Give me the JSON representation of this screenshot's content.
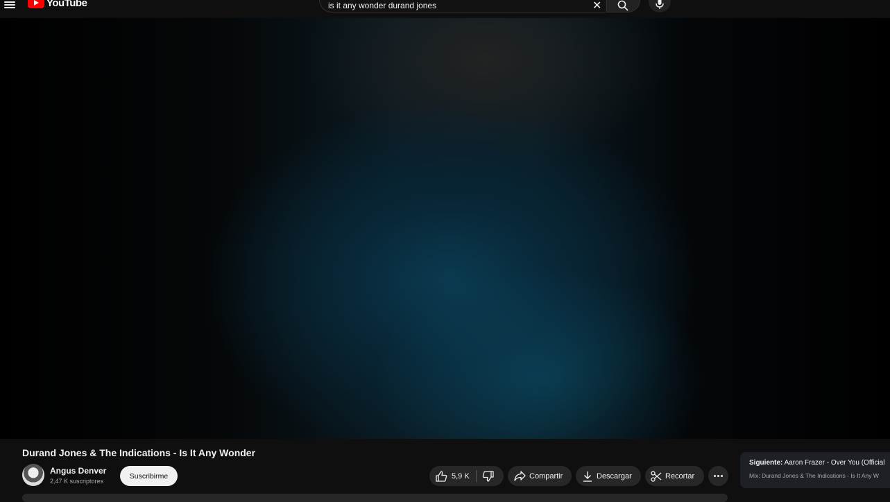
{
  "header": {
    "logo_text": "YouTube",
    "search_value": "is it any wonder durand jones",
    "icons": [
      "menu-icon",
      "youtube-logo-icon",
      "clear-icon",
      "search-icon",
      "mic-icon"
    ]
  },
  "video": {
    "title": "Durand Jones & The Indications - Is It Any Wonder",
    "channel_name": "Angus Denver",
    "subscribers": "2,47 K suscriptores",
    "subscribe_label": "Suscribirme",
    "likes": "5,9 K",
    "share_label": "Compartir",
    "download_label": "Descargar",
    "clip_label": "Recortar"
  },
  "up_next": {
    "label": "Siguiente:",
    "title": "Aaron Frazer - Over You (Official",
    "mix": "Mix: Durand Jones & The Indications - Is It Any W"
  },
  "colors": {
    "background": "#0f0f0f",
    "pill": "#272727",
    "brand": "#ff0000",
    "text": "#f1f1f1"
  }
}
